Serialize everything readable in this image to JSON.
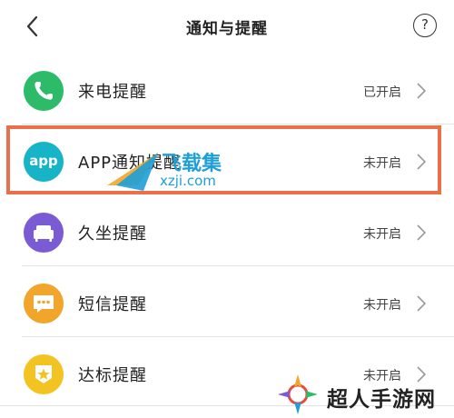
{
  "header": {
    "title": "通知与提醒",
    "help_glyph": "?"
  },
  "rows": [
    {
      "label": "来电提醒",
      "status": "已开启",
      "icon": "phone-icon",
      "color": "#2dbb6a"
    },
    {
      "label": "APP通知提醒",
      "status": "未开启",
      "icon": "app-icon",
      "color": "#17b3c6",
      "icon_text": "app"
    },
    {
      "label": "久坐提醒",
      "status": "未开启",
      "icon": "sofa-icon",
      "color": "#7b5bd3"
    },
    {
      "label": "短信提醒",
      "status": "未开启",
      "icon": "message-icon",
      "color": "#f2a52b"
    },
    {
      "label": "达标提醒",
      "status": "未开启",
      "icon": "medal-icon",
      "color": "#f2c321"
    }
  ],
  "watermarks": {
    "feizai_cn": "飞载集",
    "feizai_url": "xzji.com",
    "logo2_text": "超人手游网"
  },
  "colors": {
    "highlight": "#e8704b",
    "watermark_blue": "#1e9fd8"
  }
}
